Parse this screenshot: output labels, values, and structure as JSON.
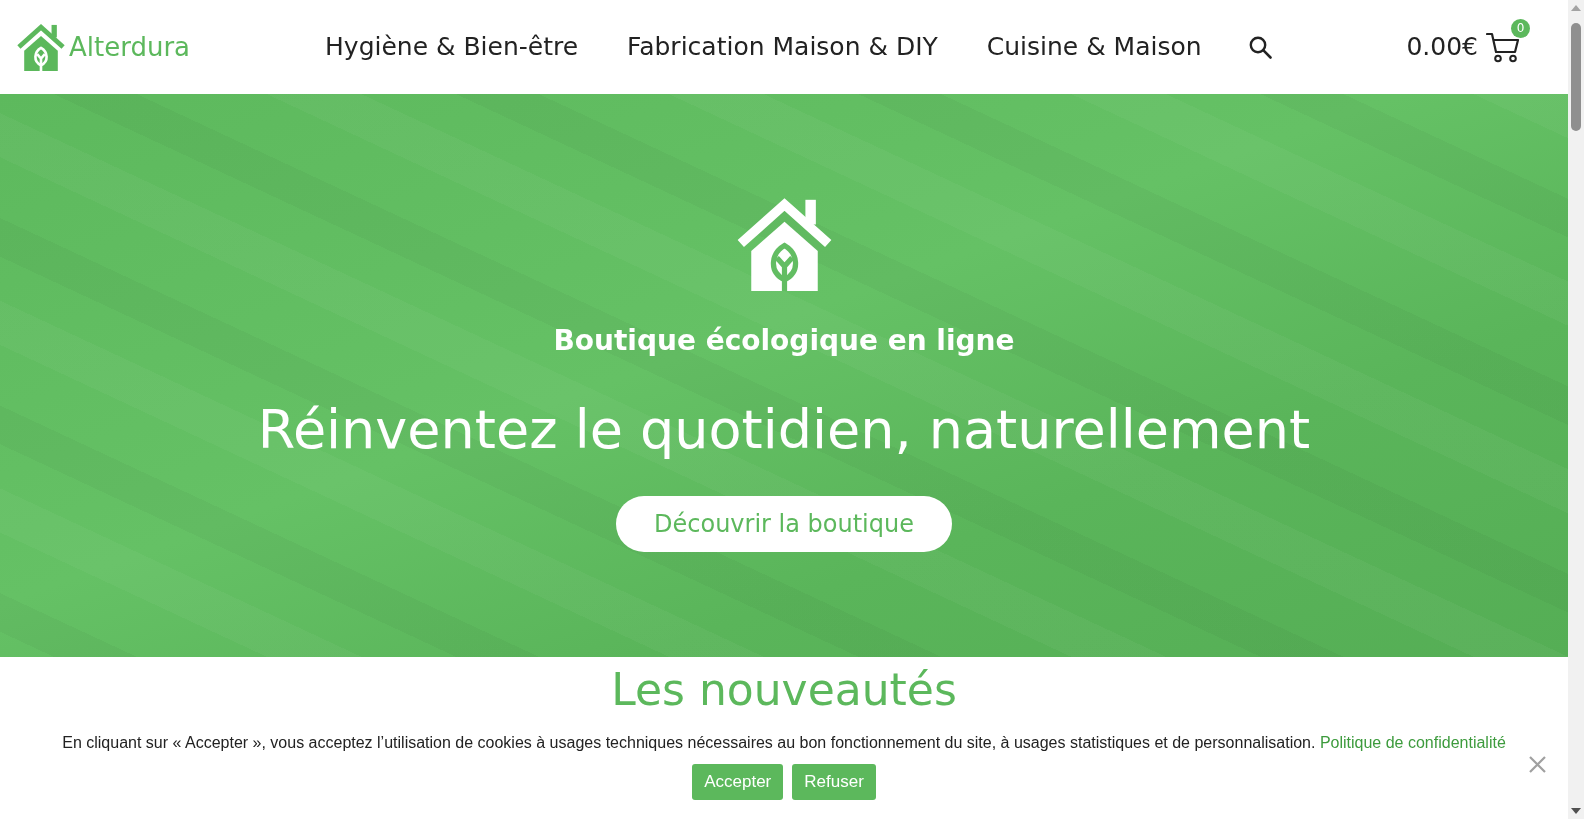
{
  "header": {
    "logo": {
      "text": "Alterdura"
    },
    "nav": [
      {
        "label": "Hygiène & Bien-être"
      },
      {
        "label": "Fabrication Maison & DIY"
      },
      {
        "label": "Cuisine & Maison"
      }
    ],
    "cart": {
      "total": "0.00€",
      "count": "0"
    }
  },
  "hero": {
    "subtitle": "Boutique écologique en ligne",
    "title": "Réinventez le quotidien, naturellement",
    "button": "Découvrir la boutique"
  },
  "section": {
    "title": "Les nouveautés"
  },
  "cookie_banner": {
    "text": "En cliquant sur « Accepter », vous acceptez l’utilisation de cookies à usages techniques nécessaires au bon fonctionnement du site, à usages statistiques et de personnalisation.",
    "link": "Politique de confidentialité",
    "buttons": [
      "Accepter",
      "Refuser"
    ]
  }
}
